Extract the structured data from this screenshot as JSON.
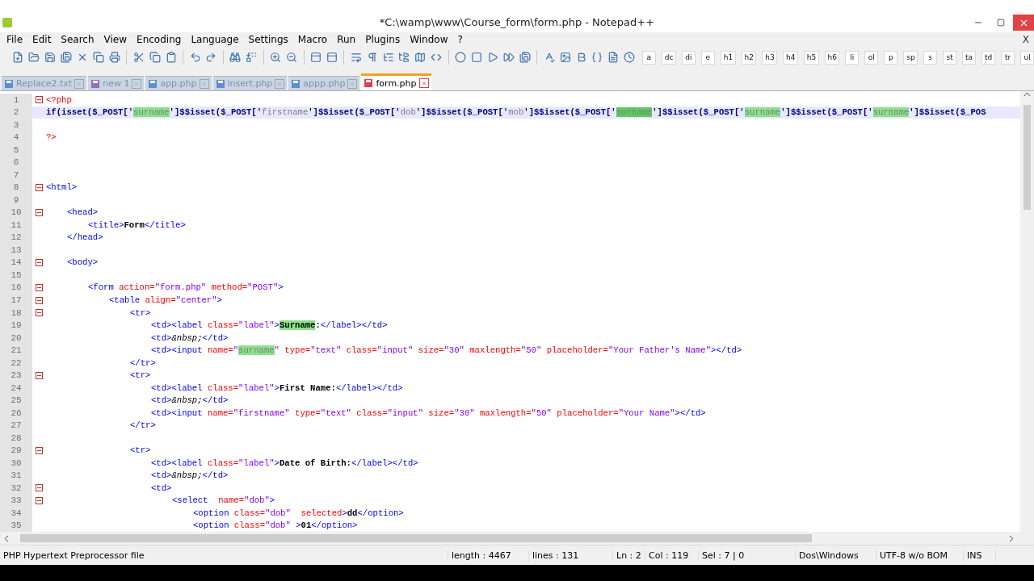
{
  "window": {
    "title": "*C:\\wamp\\www\\Course_form\\form.php - Notepad++"
  },
  "menu": {
    "items": [
      "File",
      "Edit",
      "Search",
      "View",
      "Encoding",
      "Language",
      "Settings",
      "Macro",
      "Run",
      "Plugins",
      "Window",
      "?"
    ],
    "close": "X"
  },
  "tag_buttons": [
    "a",
    "dc",
    "di",
    "e",
    "h1",
    "h2",
    "h3",
    "h4",
    "h5",
    "h6",
    "li",
    "ol",
    "p",
    "sp",
    "s",
    "st",
    "ta",
    "td",
    "tr",
    "ul"
  ],
  "tabs": [
    {
      "label": "Replace2.txt",
      "selected": false,
      "kind": "text"
    },
    {
      "label": "new  1",
      "selected": false,
      "kind": "new"
    },
    {
      "label": "app.php",
      "selected": false,
      "kind": "text"
    },
    {
      "label": "insert.php",
      "selected": false,
      "kind": "text"
    },
    {
      "label": "appp.php",
      "selected": false,
      "kind": "text"
    },
    {
      "label": "form.php",
      "selected": true,
      "kind": "modified"
    }
  ],
  "lines": [
    {
      "n": "1",
      "fold": true,
      "current": false,
      "tokens": [
        {
          "kind": "delim",
          "text": "<?php"
        }
      ]
    },
    {
      "n": "2",
      "fold": false,
      "current": true,
      "tokens": [
        {
          "kind": "php",
          "text": "if(isset($_POST['"
        },
        {
          "kind": "match",
          "text": "surname"
        },
        {
          "kind": "php",
          "text": "']$$isset($_POST['"
        },
        {
          "kind": "str",
          "text": "firstname"
        },
        {
          "kind": "php",
          "text": "']$$isset($_POST['"
        },
        {
          "kind": "str",
          "text": "dob"
        },
        {
          "kind": "php",
          "text": "']$$isset($_POST['"
        },
        {
          "kind": "str",
          "text": "mob"
        },
        {
          "kind": "php",
          "text": "']$$isset($_POST['"
        },
        {
          "kind": "sel",
          "text": "surname"
        },
        {
          "kind": "php",
          "text": "']$$isset($_POST['"
        },
        {
          "kind": "match",
          "text": "surname"
        },
        {
          "kind": "php",
          "text": "']$$isset($_POST['"
        },
        {
          "kind": "match",
          "text": "surname"
        },
        {
          "kind": "php",
          "text": "']$$isset($_POS"
        }
      ]
    },
    {
      "n": "3",
      "fold": false,
      "current": false
    },
    {
      "n": "4",
      "fold": false,
      "current": false,
      "tokens": [
        {
          "kind": "delim",
          "text": "?>"
        }
      ]
    },
    {
      "n": "5",
      "fold": false,
      "current": false
    },
    {
      "n": "6",
      "fold": false,
      "current": false
    },
    {
      "n": "7",
      "fold": false,
      "current": false
    },
    {
      "n": "8",
      "fold": true,
      "current": false,
      "tokens": [
        {
          "kind": "tag",
          "text": "<html>"
        }
      ]
    },
    {
      "n": "9",
      "fold": false,
      "current": false
    },
    {
      "n": "10",
      "fold": true,
      "current": false,
      "tokens": [
        {
          "kind": "tag",
          "text": "\t<head>"
        }
      ]
    },
    {
      "n": "11",
      "fold": false,
      "current": false,
      "tokens": [
        {
          "kind": "tag",
          "text": "\t\t<title>"
        },
        {
          "kind": "text",
          "text": "Form"
        },
        {
          "kind": "tag",
          "text": "</title>"
        }
      ]
    },
    {
      "n": "12",
      "fold": false,
      "current": false,
      "tokens": [
        {
          "kind": "tag",
          "text": "\t</head>"
        }
      ]
    },
    {
      "n": "13",
      "fold": false,
      "current": false
    },
    {
      "n": "14",
      "fold": true,
      "current": false,
      "tokens": [
        {
          "kind": "tag",
          "text": "\t<body>"
        }
      ]
    },
    {
      "n": "15",
      "fold": false,
      "current": false
    },
    {
      "n": "16",
      "fold": true,
      "current": false,
      "tokens": [
        {
          "kind": "tag",
          "text": "\t\t<form"
        },
        {
          "kind": "attr",
          "text": " action="
        },
        {
          "kind": "value",
          "text": "\"form.php\""
        },
        {
          "kind": "attr",
          "text": " method="
        },
        {
          "kind": "value",
          "text": "\"POST\""
        },
        {
          "kind": "tag",
          "text": ">"
        }
      ]
    },
    {
      "n": "17",
      "fold": true,
      "current": false,
      "tokens": [
        {
          "kind": "tag",
          "text": "\t\t\t<table"
        },
        {
          "kind": "attr",
          "text": " align="
        },
        {
          "kind": "value",
          "text": "\"center\""
        },
        {
          "kind": "tag",
          "text": ">"
        }
      ]
    },
    {
      "n": "18",
      "fold": true,
      "current": false,
      "tokens": [
        {
          "kind": "tag",
          "text": "\t\t\t\t<tr>"
        }
      ]
    },
    {
      "n": "19",
      "fold": false,
      "current": false,
      "tokens": [
        {
          "kind": "tag",
          "text": "\t\t\t\t\t<td><label"
        },
        {
          "kind": "attr",
          "text": " class="
        },
        {
          "kind": "value",
          "text": "\"label\""
        },
        {
          "kind": "tag",
          "text": ">"
        },
        {
          "kind": "textmatch",
          "text": "Surname"
        },
        {
          "kind": "text",
          "text": ":"
        },
        {
          "kind": "tag",
          "text": "</label></td>"
        }
      ]
    },
    {
      "n": "20",
      "fold": false,
      "current": false,
      "tokens": [
        {
          "kind": "tag",
          "text": "\t\t\t\t\t<td>"
        },
        {
          "kind": "entity",
          "text": "&nbsp;"
        },
        {
          "kind": "tag",
          "text": "</td>"
        }
      ]
    },
    {
      "n": "21",
      "fold": false,
      "current": false,
      "tokens": [
        {
          "kind": "tag",
          "text": "\t\t\t\t\t<td><input"
        },
        {
          "kind": "attr",
          "text": " name="
        },
        {
          "kind": "value",
          "text": "\""
        },
        {
          "kind": "match",
          "text": "surname"
        },
        {
          "kind": "value",
          "text": "\""
        },
        {
          "kind": "attr",
          "text": " type="
        },
        {
          "kind": "value",
          "text": "\"text\""
        },
        {
          "kind": "attr",
          "text": " class="
        },
        {
          "kind": "value",
          "text": "\"input\""
        },
        {
          "kind": "attr",
          "text": " size="
        },
        {
          "kind": "value",
          "text": "\"30\""
        },
        {
          "kind": "attr",
          "text": " maxlength="
        },
        {
          "kind": "value",
          "text": "\"50\""
        },
        {
          "kind": "attr",
          "text": " placeholder="
        },
        {
          "kind": "value",
          "text": "\"Your Father's Name\""
        },
        {
          "kind": "tag",
          "text": "></td>"
        }
      ]
    },
    {
      "n": "22",
      "fold": false,
      "current": false,
      "tokens": [
        {
          "kind": "tag",
          "text": "\t\t\t\t</tr>"
        }
      ]
    },
    {
      "n": "23",
      "fold": true,
      "current": false,
      "tokens": [
        {
          "kind": "tag",
          "text": "\t\t\t\t<tr>"
        }
      ]
    },
    {
      "n": "24",
      "fold": false,
      "current": false,
      "tokens": [
        {
          "kind": "tag",
          "text": "\t\t\t\t\t<td><label"
        },
        {
          "kind": "attr",
          "text": " class="
        },
        {
          "kind": "value",
          "text": "\"label\""
        },
        {
          "kind": "tag",
          "text": ">"
        },
        {
          "kind": "text",
          "text": "First Name:"
        },
        {
          "kind": "tag",
          "text": "</label></td>"
        }
      ]
    },
    {
      "n": "25",
      "fold": false,
      "current": false,
      "tokens": [
        {
          "kind": "tag",
          "text": "\t\t\t\t\t<td>"
        },
        {
          "kind": "entity",
          "text": "&nbsp;"
        },
        {
          "kind": "tag",
          "text": "</td>"
        }
      ]
    },
    {
      "n": "26",
      "fold": false,
      "current": false,
      "tokens": [
        {
          "kind": "tag",
          "text": "\t\t\t\t\t<td><input"
        },
        {
          "kind": "attr",
          "text": " name="
        },
        {
          "kind": "value",
          "text": "\"firstname\""
        },
        {
          "kind": "attr",
          "text": " type="
        },
        {
          "kind": "value",
          "text": "\"text\""
        },
        {
          "kind": "attr",
          "text": " class="
        },
        {
          "kind": "value",
          "text": "\"input\""
        },
        {
          "kind": "attr",
          "text": " size="
        },
        {
          "kind": "value",
          "text": "\"30\""
        },
        {
          "kind": "attr",
          "text": " maxlength="
        },
        {
          "kind": "value",
          "text": "\"50\""
        },
        {
          "kind": "attr",
          "text": " placeholder="
        },
        {
          "kind": "value",
          "text": "\"Your Name\""
        },
        {
          "kind": "tag",
          "text": "></td>"
        }
      ]
    },
    {
      "n": "27",
      "fold": false,
      "current": false,
      "tokens": [
        {
          "kind": "tag",
          "text": "\t\t\t\t</tr>"
        }
      ]
    },
    {
      "n": "28",
      "fold": false,
      "current": false
    },
    {
      "n": "29",
      "fold": true,
      "current": false,
      "tokens": [
        {
          "kind": "tag",
          "text": "\t\t\t\t<tr>"
        }
      ]
    },
    {
      "n": "30",
      "fold": false,
      "current": false,
      "tokens": [
        {
          "kind": "tag",
          "text": "\t\t\t\t\t<td><label"
        },
        {
          "kind": "attr",
          "text": " class="
        },
        {
          "kind": "value",
          "text": "\"label\""
        },
        {
          "kind": "tag",
          "text": ">"
        },
        {
          "kind": "text",
          "text": "Date of Birth:"
        },
        {
          "kind": "tag",
          "text": "</label></td>"
        }
      ]
    },
    {
      "n": "31",
      "fold": false,
      "current": false,
      "tokens": [
        {
          "kind": "tag",
          "text": "\t\t\t\t\t<td>"
        },
        {
          "kind": "entity",
          "text": "&nbsp;"
        },
        {
          "kind": "tag",
          "text": "</td>"
        }
      ]
    },
    {
      "n": "32",
      "fold": true,
      "current": false,
      "tokens": [
        {
          "kind": "tag",
          "text": "\t\t\t\t\t<td>"
        }
      ]
    },
    {
      "n": "33",
      "fold": true,
      "current": false,
      "tokens": [
        {
          "kind": "tag",
          "text": "\t\t\t\t\t\t<select"
        },
        {
          "kind": "attr",
          "text": "  name="
        },
        {
          "kind": "value",
          "text": "\"dob\""
        },
        {
          "kind": "tag",
          "text": ">"
        }
      ]
    },
    {
      "n": "34",
      "fold": false,
      "current": false,
      "tokens": [
        {
          "kind": "tag",
          "text": "\t\t\t\t\t\t\t<option"
        },
        {
          "kind": "attr",
          "text": " class="
        },
        {
          "kind": "value",
          "text": "\"dob\""
        },
        {
          "kind": "attr",
          "text": "  selected"
        },
        {
          "kind": "tag",
          "text": ">"
        },
        {
          "kind": "text",
          "text": "dd"
        },
        {
          "kind": "tag",
          "text": "</option>"
        }
      ]
    },
    {
      "n": "35",
      "fold": false,
      "current": false,
      "tokens": [
        {
          "kind": "tag",
          "text": "\t\t\t\t\t\t\t<option"
        },
        {
          "kind": "attr",
          "text": " class="
        },
        {
          "kind": "value",
          "text": "\"dob\""
        },
        {
          "kind": "tag",
          "text": " >"
        },
        {
          "kind": "text",
          "text": "01"
        },
        {
          "kind": "tag",
          "text": "</option>"
        }
      ]
    }
  ],
  "status_bar": {
    "file_type": "PHP Hypertext Preprocessor file",
    "length": "length : 4467",
    "lines": "lines : 131",
    "ln": "Ln : 2",
    "col": "Col : 119",
    "sel": "Sel : 7 | 0",
    "eol": "Dos\\Windows",
    "encoding": "UTF-8 w/o BOM",
    "mode": "INS"
  }
}
